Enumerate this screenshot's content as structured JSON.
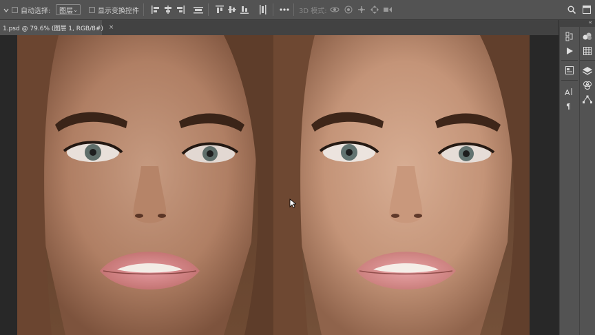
{
  "options_bar": {
    "auto_select_label": "自动选择:",
    "auto_select_value": "图层",
    "show_transform_label": "显示变换控件",
    "mode_3d_label": "3D 模式:"
  },
  "document": {
    "tab_title": "1.psd @ 79.6% (图层 1, RGB/8#)",
    "close_glyph": "×"
  },
  "panel": {
    "collapse_glyph": "«"
  },
  "colors": {
    "optbar_bg": "#535353",
    "tabbar_bg": "#424242",
    "canvas_bg": "#282828",
    "panel_bg": "#535353"
  },
  "icons": [
    "dropdown-arrow-icon",
    "align-left-icon",
    "align-hcenter-icon",
    "align-right-icon",
    "align-top-edges-icon",
    "distribute-top-icon",
    "align-vcenter-icon",
    "distribute-vcenter-icon",
    "align-bottom-icon",
    "more-options-icon",
    "orbit-3d-icon",
    "roll-3d-icon",
    "drag-3d-icon",
    "slide-3d-icon",
    "scale-3d-icon",
    "search-icon",
    "workspace-icon",
    "history-icon",
    "play-icon",
    "properties-icon",
    "character-icon",
    "paragraph-icon",
    "color-wheel-icon",
    "swatches-icon",
    "layers-icon",
    "channels-icon",
    "paths-icon"
  ]
}
